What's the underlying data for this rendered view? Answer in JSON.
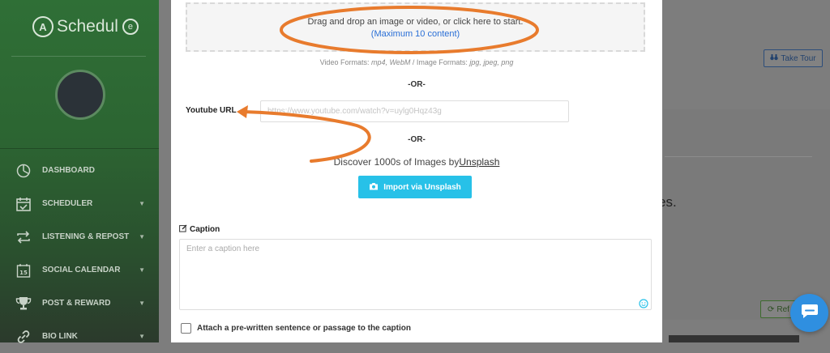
{
  "app": {
    "logo_prefix": "A",
    "logo_text": "Schedul",
    "logo_suffix": "e"
  },
  "sidebar": {
    "items": [
      {
        "label": "DASHBOARD",
        "icon": "pie-chart-icon",
        "has_submenu": false
      },
      {
        "label": "SCHEDULER",
        "icon": "calendar-check-icon",
        "has_submenu": true
      },
      {
        "label": "LISTENING & REPOST",
        "icon": "repost-icon",
        "has_submenu": true
      },
      {
        "label": "SOCIAL CALENDAR",
        "icon": "calendar-15-icon",
        "has_submenu": true
      },
      {
        "label": "POST & REWARD",
        "icon": "trophy-icon",
        "has_submenu": true
      },
      {
        "label": "BIO LINK",
        "icon": "link-icon",
        "has_submenu": true
      }
    ]
  },
  "background": {
    "take_tour": "Take Tour",
    "partial_text": "es.",
    "refresh_partial": "Ref"
  },
  "modal": {
    "dropzone": {
      "main": "Drag and drop an image or video, or click here to start.",
      "sub": "(Maximum 10 content)"
    },
    "formats_prefix": "Video Formats: ",
    "video_formats": "mp4, WebM",
    "formats_mid": " / Image Formats: ",
    "image_formats": "jpg, jpeg, png",
    "or_1": "-OR-",
    "youtube_label": "Youtube URL",
    "youtube_placeholder": "https://www.youtube.com/watch?v=uylg0Hqz43g",
    "or_2": "-OR-",
    "discover_prefix": "Discover 1000s of Images by",
    "discover_link": "Unsplash",
    "import_button": "Import via Unsplash",
    "caption_label": "Caption",
    "caption_placeholder": "Enter a caption here",
    "attach_label": "Attach a pre-written sentence or passage to the caption"
  },
  "colors": {
    "accent_cyan": "#27c1e8",
    "annotation_orange": "#e87b2d",
    "link_blue": "#2a6fd6",
    "chat_blue": "#2f8fe0"
  }
}
